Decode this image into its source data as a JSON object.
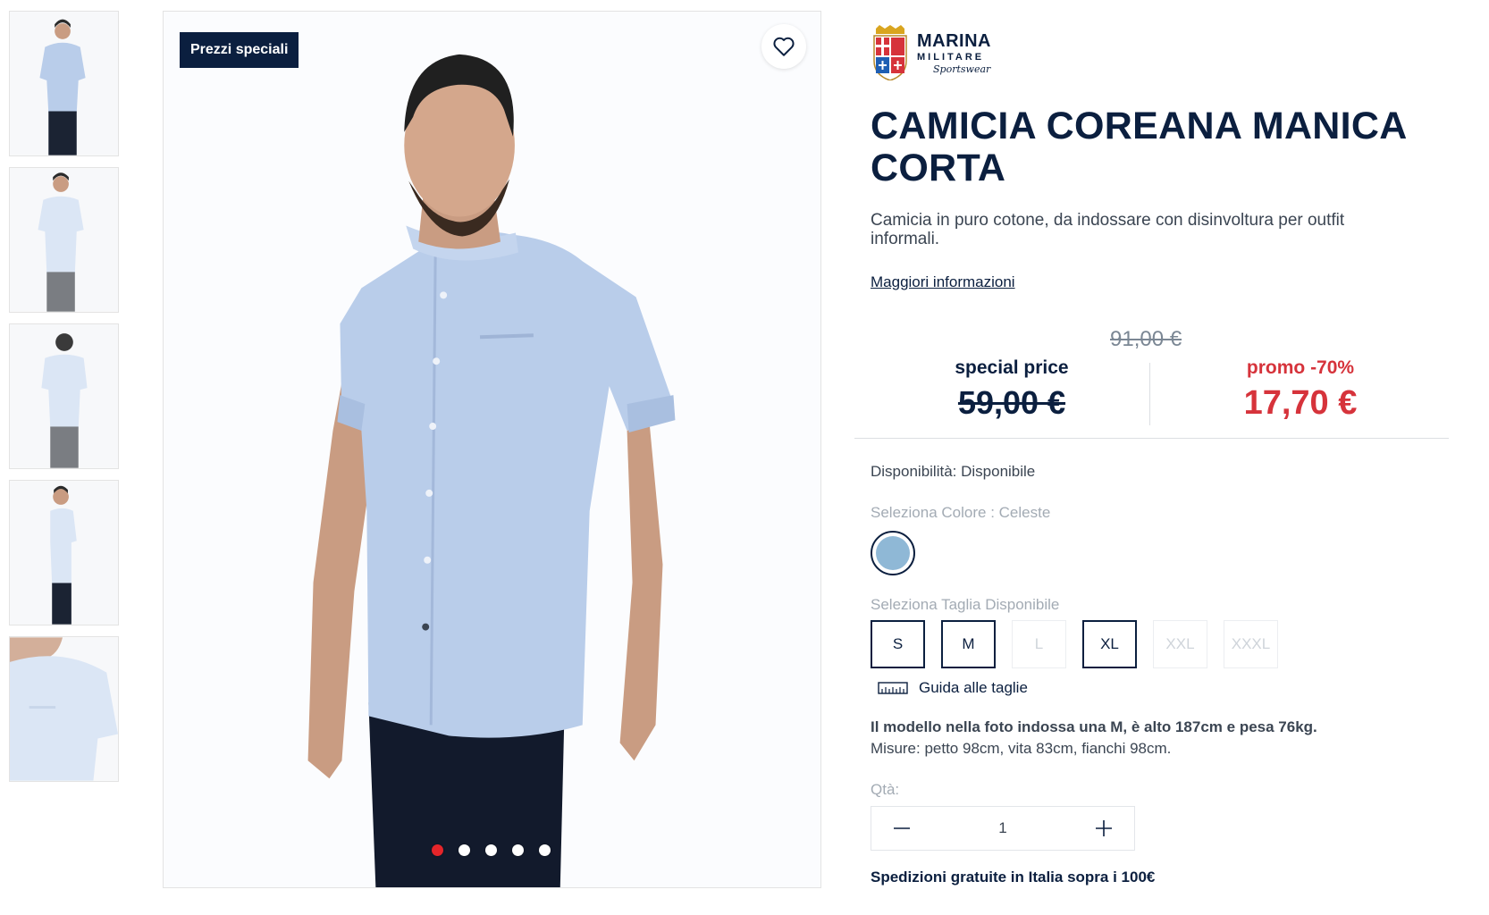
{
  "thumbnails": [
    "front",
    "front-detail",
    "back",
    "side",
    "close-up"
  ],
  "main_image": {
    "badge": "Prezzi speciali",
    "dots_total": 5,
    "active_dot": 0
  },
  "brand": {
    "name_line1": "MARINA",
    "name_line2": "MILITARE",
    "name_line3": "Sportswear"
  },
  "product": {
    "title": "CAMICIA COREANA MANICA CORTA",
    "description": "Camicia in puro cotone, da indossare con disinvoltura per outfit informali.",
    "more_link": "Maggiori informazioni"
  },
  "pricing": {
    "original": "91,00 €",
    "special_label": "special price",
    "special_value": "59,00 €",
    "promo_label": "promo -70%",
    "promo_value": "17,70 €"
  },
  "availability": "Disponibilità: Disponibile",
  "color": {
    "label": "Seleziona Colore : Celeste",
    "swatch_hex": "#8fb8d6"
  },
  "size": {
    "label": "Seleziona Taglia Disponibile",
    "options": [
      {
        "label": "S",
        "available": true
      },
      {
        "label": "M",
        "available": true
      },
      {
        "label": "L",
        "available": false
      },
      {
        "label": "XL",
        "available": true
      },
      {
        "label": "XXL",
        "available": false
      },
      {
        "label": "XXXL",
        "available": false
      }
    ],
    "guide": "Guida alle taglie"
  },
  "model_info": {
    "line1": "Il modello nella foto indossa una M, è alto 187cm e pesa 76kg.",
    "line2": "Misure: petto 98cm, vita 83cm, fianchi 98cm."
  },
  "quantity": {
    "label": "Qtà:",
    "value": "1"
  },
  "shipping": "Spedizioni gratuite in Italia sopra i 100€",
  "colors": {
    "navy": "#0b1f3f",
    "promo_red": "#d6333b",
    "active_dot": "#e5252a",
    "shirt": "#b9cdea"
  }
}
